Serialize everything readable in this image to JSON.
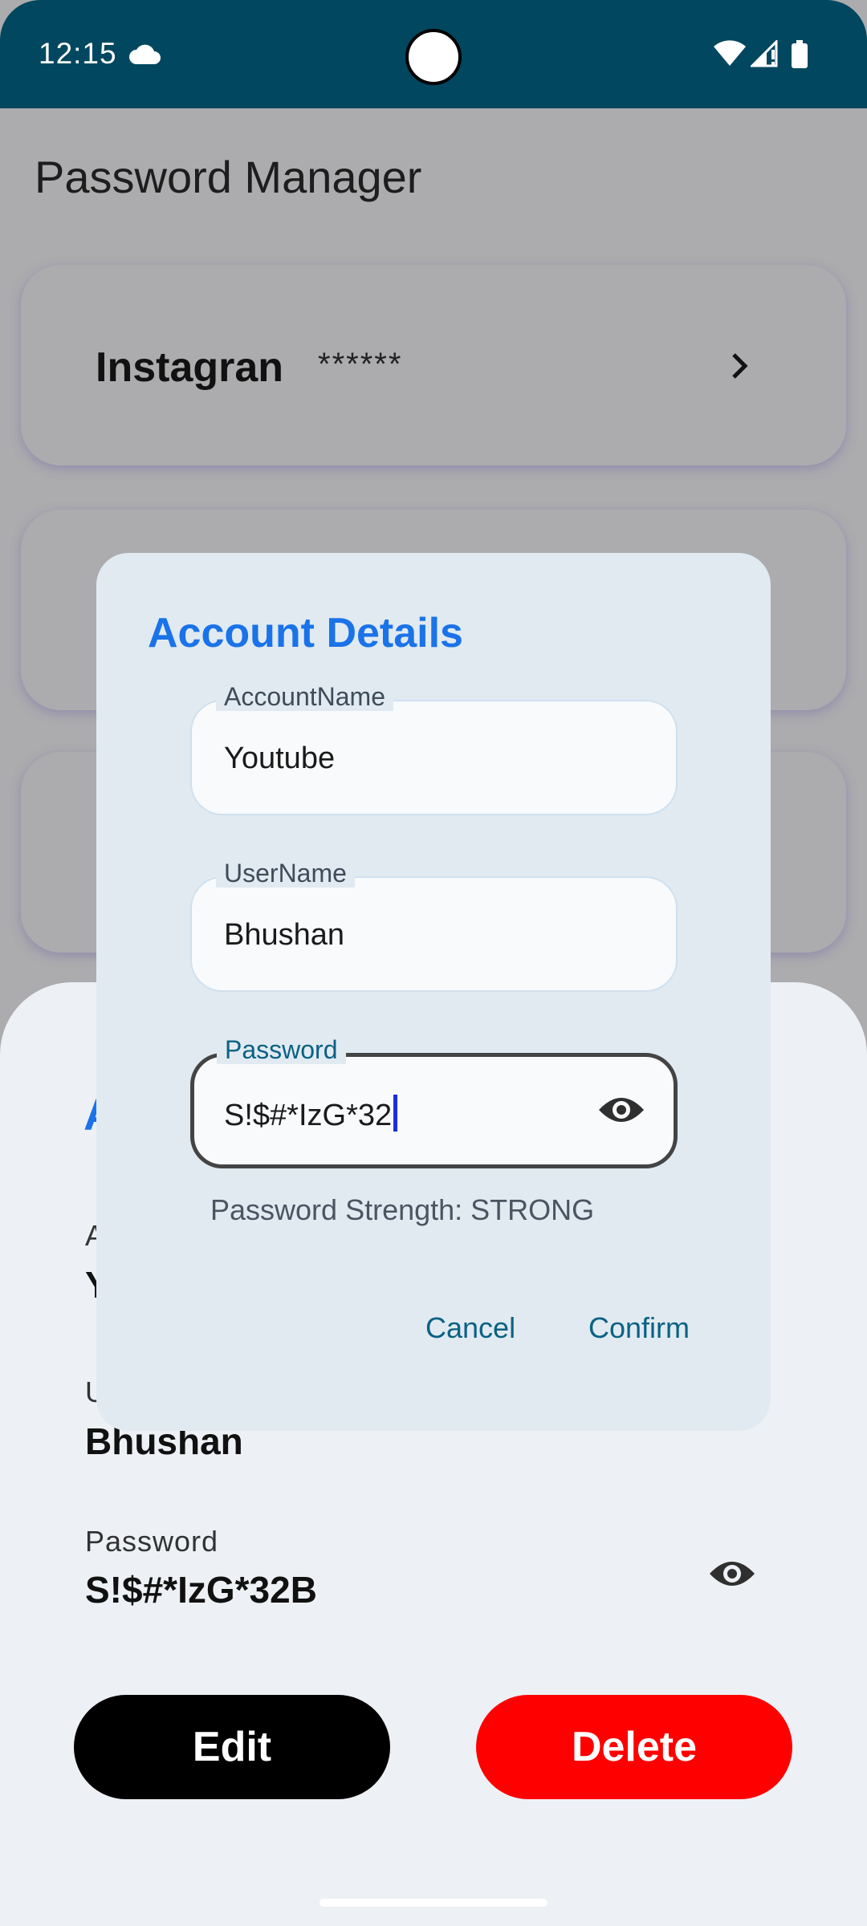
{
  "status_bar": {
    "time": "12:15",
    "icons": [
      "cloud-icon",
      "wifi-icon",
      "signal-icon",
      "battery-icon"
    ]
  },
  "app": {
    "title": "Password Manager",
    "cards": [
      {
        "name": "Instagran",
        "masked_password": "******"
      }
    ]
  },
  "sheet": {
    "title_partial": "A",
    "account_label_partial": "A",
    "account_value_partial": "Y",
    "username_label_partial": "U",
    "username_value": "Bhushan",
    "password_label": "Password",
    "password_value": "S!$#*IzG*32B",
    "edit_label": "Edit",
    "delete_label": "Delete"
  },
  "dialog": {
    "title": "Account Details",
    "fields": [
      {
        "label": "AccountName",
        "value": "Youtube"
      },
      {
        "label": "UserName",
        "value": "Bhushan"
      },
      {
        "label": "Password",
        "value": "S!$#*IzG*32"
      }
    ],
    "strength_text": "Password Strength: STRONG",
    "cancel_label": "Cancel",
    "confirm_label": "Confirm"
  },
  "colors": {
    "status_bar": "#00475f",
    "accent_title": "#1a73e8",
    "dialog_button": "#0b6184",
    "delete": "#ff0000",
    "edit": "#000000"
  }
}
